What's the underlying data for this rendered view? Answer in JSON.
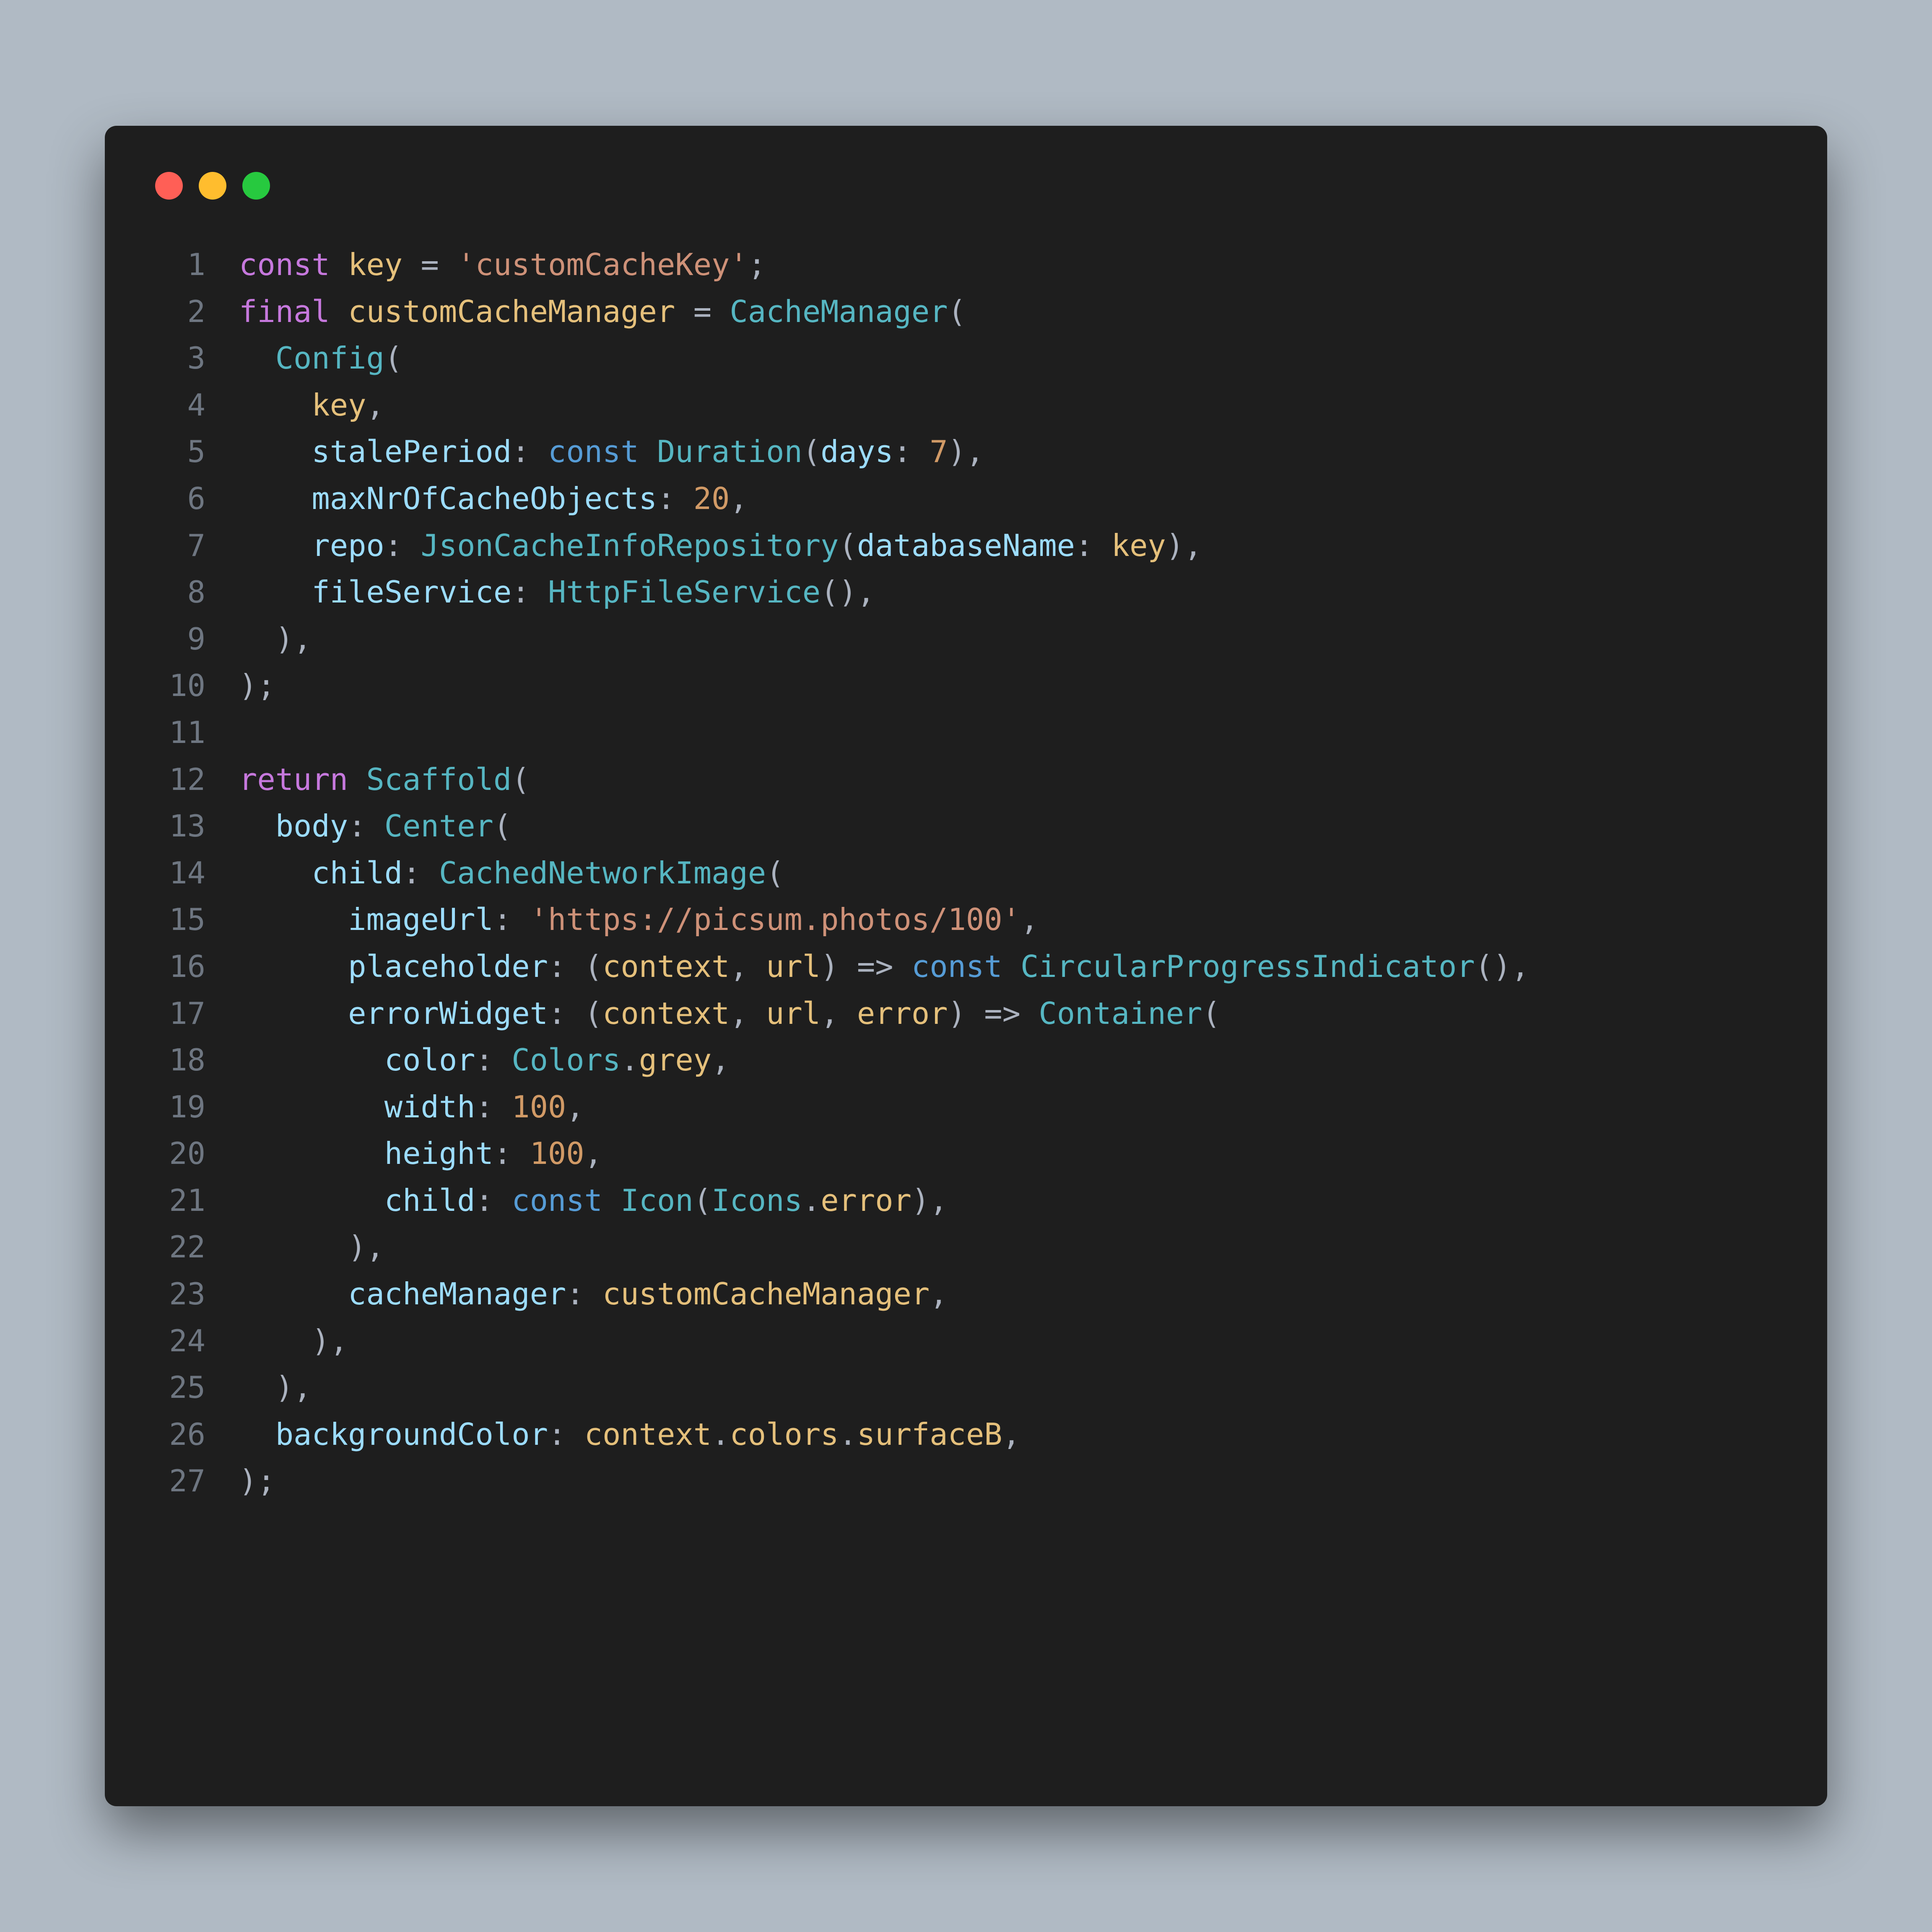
{
  "window": {
    "traffic_red": "close",
    "traffic_yellow": "minimize",
    "traffic_green": "zoom"
  },
  "code": {
    "lines": [
      {
        "n": "1",
        "tokens": [
          [
            "kw",
            "const"
          ],
          [
            "op",
            " "
          ],
          [
            "ident",
            "key"
          ],
          [
            "op",
            " = "
          ],
          [
            "str",
            "'customCacheKey'"
          ],
          [
            "op",
            ";"
          ]
        ]
      },
      {
        "n": "2",
        "tokens": [
          [
            "kw",
            "final"
          ],
          [
            "op",
            " "
          ],
          [
            "ident",
            "customCacheManager"
          ],
          [
            "op",
            " = "
          ],
          [
            "cls",
            "CacheManager"
          ],
          [
            "op",
            "("
          ]
        ]
      },
      {
        "n": "3",
        "tokens": [
          [
            "op",
            "  "
          ],
          [
            "cls",
            "Config"
          ],
          [
            "op",
            "("
          ]
        ]
      },
      {
        "n": "4",
        "tokens": [
          [
            "op",
            "    "
          ],
          [
            "ident",
            "key"
          ],
          [
            "op",
            ","
          ]
        ]
      },
      {
        "n": "5",
        "tokens": [
          [
            "op",
            "    "
          ],
          [
            "param",
            "stalePeriod"
          ],
          [
            "op",
            ": "
          ],
          [
            "kw2",
            "const"
          ],
          [
            "op",
            " "
          ],
          [
            "cls",
            "Duration"
          ],
          [
            "op",
            "("
          ],
          [
            "param",
            "days"
          ],
          [
            "op",
            ": "
          ],
          [
            "num",
            "7"
          ],
          [
            "op",
            "),"
          ]
        ]
      },
      {
        "n": "6",
        "tokens": [
          [
            "op",
            "    "
          ],
          [
            "param",
            "maxNrOfCacheObjects"
          ],
          [
            "op",
            ": "
          ],
          [
            "num",
            "20"
          ],
          [
            "op",
            ","
          ]
        ]
      },
      {
        "n": "7",
        "tokens": [
          [
            "op",
            "    "
          ],
          [
            "param",
            "repo"
          ],
          [
            "op",
            ": "
          ],
          [
            "cls",
            "JsonCacheInfoRepository"
          ],
          [
            "op",
            "("
          ],
          [
            "param",
            "databaseName"
          ],
          [
            "op",
            ": "
          ],
          [
            "ident",
            "key"
          ],
          [
            "op",
            "),"
          ]
        ]
      },
      {
        "n": "8",
        "tokens": [
          [
            "op",
            "    "
          ],
          [
            "param",
            "fileService"
          ],
          [
            "op",
            ": "
          ],
          [
            "cls",
            "HttpFileService"
          ],
          [
            "op",
            "(),"
          ]
        ]
      },
      {
        "n": "9",
        "tokens": [
          [
            "op",
            "  ),"
          ]
        ]
      },
      {
        "n": "10",
        "tokens": [
          [
            "op",
            ");"
          ]
        ]
      },
      {
        "n": "11",
        "tokens": [
          [
            "op",
            ""
          ]
        ]
      },
      {
        "n": "12",
        "tokens": [
          [
            "kw",
            "return"
          ],
          [
            "op",
            " "
          ],
          [
            "cls",
            "Scaffold"
          ],
          [
            "op",
            "("
          ]
        ]
      },
      {
        "n": "13",
        "tokens": [
          [
            "op",
            "  "
          ],
          [
            "param",
            "body"
          ],
          [
            "op",
            ": "
          ],
          [
            "cls",
            "Center"
          ],
          [
            "op",
            "("
          ]
        ]
      },
      {
        "n": "14",
        "tokens": [
          [
            "op",
            "    "
          ],
          [
            "param",
            "child"
          ],
          [
            "op",
            ": "
          ],
          [
            "cls",
            "CachedNetworkImage"
          ],
          [
            "op",
            "("
          ]
        ]
      },
      {
        "n": "15",
        "tokens": [
          [
            "op",
            "      "
          ],
          [
            "param",
            "imageUrl"
          ],
          [
            "op",
            ": "
          ],
          [
            "str",
            "'https://picsum.photos/100'"
          ],
          [
            "op",
            ","
          ]
        ]
      },
      {
        "n": "16",
        "tokens": [
          [
            "op",
            "      "
          ],
          [
            "param",
            "placeholder"
          ],
          [
            "op",
            ": ("
          ],
          [
            "ident",
            "context"
          ],
          [
            "op",
            ", "
          ],
          [
            "ident",
            "url"
          ],
          [
            "op",
            ") => "
          ],
          [
            "kw2",
            "const"
          ],
          [
            "op",
            " "
          ],
          [
            "cls",
            "CircularProgressIndicator"
          ],
          [
            "op",
            "(),"
          ]
        ]
      },
      {
        "n": "17",
        "tokens": [
          [
            "op",
            "      "
          ],
          [
            "param",
            "errorWidget"
          ],
          [
            "op",
            ": ("
          ],
          [
            "ident",
            "context"
          ],
          [
            "op",
            ", "
          ],
          [
            "ident",
            "url"
          ],
          [
            "op",
            ", "
          ],
          [
            "ident",
            "error"
          ],
          [
            "op",
            ") => "
          ],
          [
            "cls",
            "Container"
          ],
          [
            "op",
            "("
          ]
        ]
      },
      {
        "n": "18",
        "tokens": [
          [
            "op",
            "        "
          ],
          [
            "param",
            "color"
          ],
          [
            "op",
            ": "
          ],
          [
            "cls",
            "Colors"
          ],
          [
            "op",
            "."
          ],
          [
            "ident",
            "grey"
          ],
          [
            "op",
            ","
          ]
        ]
      },
      {
        "n": "19",
        "tokens": [
          [
            "op",
            "        "
          ],
          [
            "param",
            "width"
          ],
          [
            "op",
            ": "
          ],
          [
            "num",
            "100"
          ],
          [
            "op",
            ","
          ]
        ]
      },
      {
        "n": "20",
        "tokens": [
          [
            "op",
            "        "
          ],
          [
            "param",
            "height"
          ],
          [
            "op",
            ": "
          ],
          [
            "num",
            "100"
          ],
          [
            "op",
            ","
          ]
        ]
      },
      {
        "n": "21",
        "tokens": [
          [
            "op",
            "        "
          ],
          [
            "param",
            "child"
          ],
          [
            "op",
            ": "
          ],
          [
            "kw2",
            "const"
          ],
          [
            "op",
            " "
          ],
          [
            "cls",
            "Icon"
          ],
          [
            "op",
            "("
          ],
          [
            "cls",
            "Icons"
          ],
          [
            "op",
            "."
          ],
          [
            "ident",
            "error"
          ],
          [
            "op",
            "),"
          ]
        ]
      },
      {
        "n": "22",
        "tokens": [
          [
            "op",
            "      ),"
          ]
        ]
      },
      {
        "n": "23",
        "tokens": [
          [
            "op",
            "      "
          ],
          [
            "param",
            "cacheManager"
          ],
          [
            "op",
            ": "
          ],
          [
            "ident",
            "customCacheManager"
          ],
          [
            "op",
            ","
          ]
        ]
      },
      {
        "n": "24",
        "tokens": [
          [
            "op",
            "    ),"
          ]
        ]
      },
      {
        "n": "25",
        "tokens": [
          [
            "op",
            "  ),"
          ]
        ]
      },
      {
        "n": "26",
        "tokens": [
          [
            "op",
            "  "
          ],
          [
            "param",
            "backgroundColor"
          ],
          [
            "op",
            ": "
          ],
          [
            "ident",
            "context"
          ],
          [
            "op",
            "."
          ],
          [
            "ident",
            "colors"
          ],
          [
            "op",
            "."
          ],
          [
            "ident",
            "surfaceB"
          ],
          [
            "op",
            ","
          ]
        ]
      },
      {
        "n": "27",
        "tokens": [
          [
            "op",
            ");"
          ]
        ]
      }
    ]
  }
}
